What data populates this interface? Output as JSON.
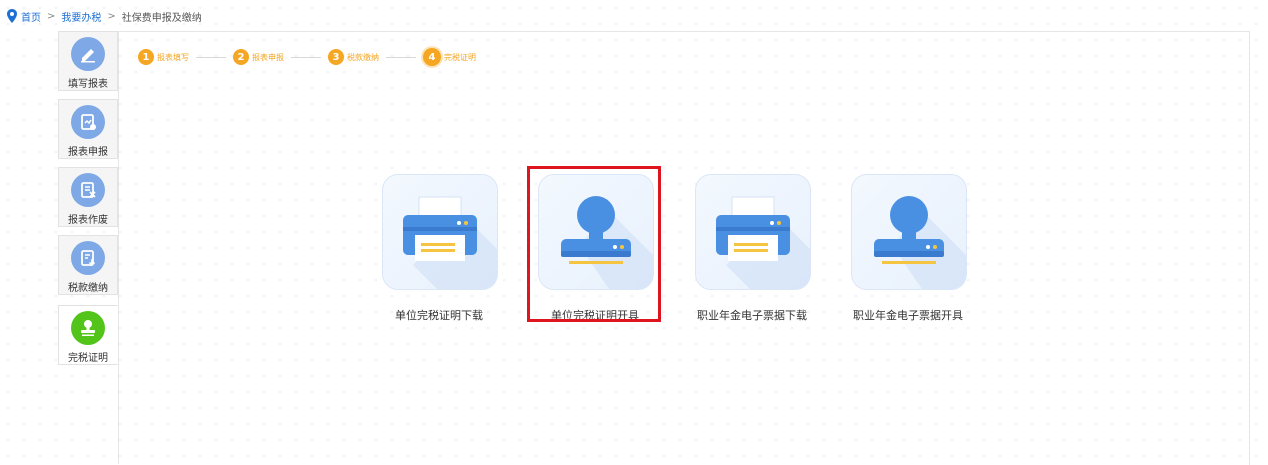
{
  "breadcrumb": {
    "home": "首页",
    "level2": "我要办税",
    "current": "社保费申报及缴纳",
    "separator": ">"
  },
  "sidebar": {
    "items": [
      {
        "label": "填写报表",
        "icon": "pencil-icon",
        "active": false
      },
      {
        "label": "报表申报",
        "icon": "report-submit-icon",
        "active": false
      },
      {
        "label": "报表作废",
        "icon": "report-void-icon",
        "active": false
      },
      {
        "label": "税款缴纳",
        "icon": "tax-pay-icon",
        "active": false
      },
      {
        "label": "完税证明",
        "icon": "stamp-icon",
        "active": true
      }
    ]
  },
  "steps": [
    {
      "num": "1",
      "label": "报表填写"
    },
    {
      "num": "2",
      "label": "报表申报"
    },
    {
      "num": "3",
      "label": "税款缴纳"
    },
    {
      "num": "4",
      "label": "完税证明",
      "current": true
    }
  ],
  "tiles": [
    {
      "label": "单位完税证明下载",
      "icon": "printer-icon"
    },
    {
      "label": "单位完税证明开具",
      "icon": "stamp-icon",
      "highlighted": true
    },
    {
      "label": "职业年金电子票据下载",
      "icon": "printer-icon"
    },
    {
      "label": "职业年金电子票据开具",
      "icon": "stamp-icon"
    }
  ],
  "colors": {
    "accent_orange": "#f5a623",
    "link_blue": "#1e6fd6",
    "active_green": "#52c41a",
    "icon_blue": "#4a90e2",
    "highlight_red": "#e0141e"
  }
}
